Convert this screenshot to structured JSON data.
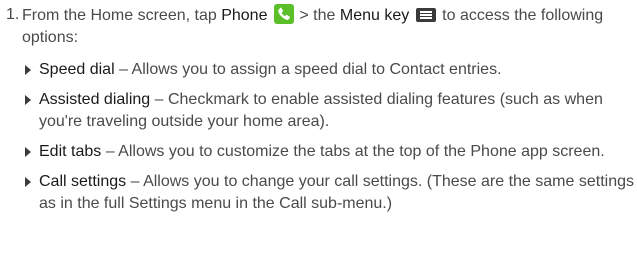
{
  "step": {
    "number": "1.",
    "intro": "From the Home screen, tap",
    "phone_label": "Phone",
    "phone_icon": "phone-icon",
    "separator": ">",
    "the": "the",
    "menu_key_label": "Menu key",
    "menu_icon": "menu-key-icon",
    "outro": "to access the following options:"
  },
  "options": [
    {
      "term": "Speed dial",
      "description": "– Allows you to assign a speed dial to Contact entries."
    },
    {
      "term": "Assisted dialing",
      "description": "– Checkmark to enable assisted dialing features (such as when you're traveling outside your home area)."
    },
    {
      "term": "Edit tabs",
      "description": "– Allows you to customize the tabs at the top of the Phone app screen."
    },
    {
      "term": "Call settings",
      "description": "– Allows you to change your call settings. (These are the same settings as in the full Settings menu in the Call sub-menu.)"
    }
  ],
  "colors": {
    "body_text": "#4a4a4a",
    "term_text": "#1a1a1a",
    "phone_icon_bg": "#5bbf2a",
    "menu_icon_bg": "#3a3a3a"
  }
}
